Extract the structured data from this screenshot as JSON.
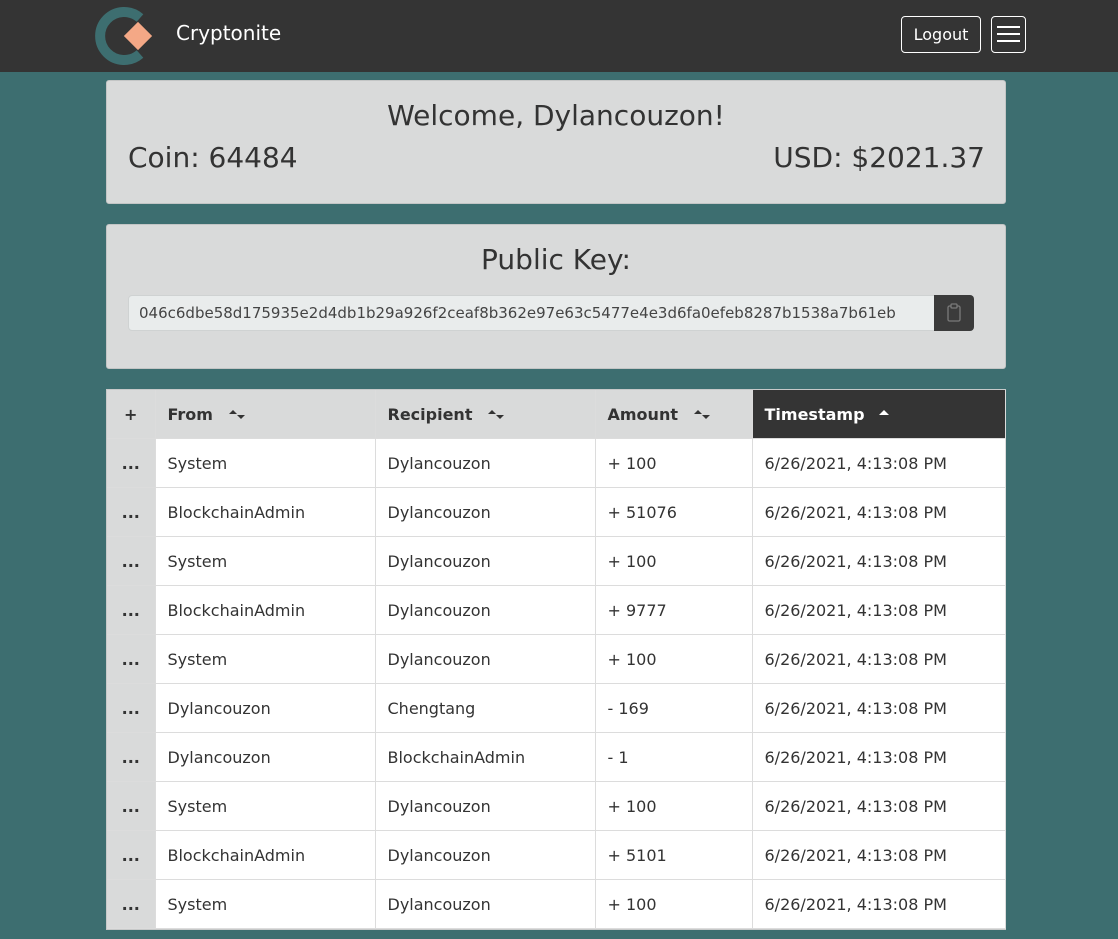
{
  "navbar": {
    "brand_name": "Cryptonite",
    "logout_label": "Logout",
    "colors": {
      "background": "#343434",
      "logo_ring": "#3d6e70",
      "logo_diamond": "#f4a886"
    }
  },
  "welcome": {
    "title": "Welcome, Dylancouzon!",
    "coin": "Coin: 64484",
    "usd": "USD: $2021.37"
  },
  "public_key": {
    "title": "Public Key:",
    "value": "046c6dbe58d175935e2d4db1b29a926f2ceaf8b362e97e63c5477e4e3d6fa0efeb8287b1538a7b61eb"
  },
  "table": {
    "add_label": "+",
    "columns": [
      "From",
      "Recipient",
      "Amount",
      "Timestamp"
    ],
    "active_sort_column": "Timestamp",
    "rows": [
      {
        "action": "...",
        "from": "System",
        "recipient": "Dylancouzon",
        "amount": "+ 100",
        "timestamp": "6/26/2021, 4:13:08 PM"
      },
      {
        "action": "...",
        "from": "BlockchainAdmin",
        "recipient": "Dylancouzon",
        "amount": "+ 51076",
        "timestamp": "6/26/2021, 4:13:08 PM"
      },
      {
        "action": "...",
        "from": "System",
        "recipient": "Dylancouzon",
        "amount": "+ 100",
        "timestamp": "6/26/2021, 4:13:08 PM"
      },
      {
        "action": "...",
        "from": "BlockchainAdmin",
        "recipient": "Dylancouzon",
        "amount": "+ 9777",
        "timestamp": "6/26/2021, 4:13:08 PM"
      },
      {
        "action": "...",
        "from": "System",
        "recipient": "Dylancouzon",
        "amount": "+ 100",
        "timestamp": "6/26/2021, 4:13:08 PM"
      },
      {
        "action": "...",
        "from": "Dylancouzon",
        "recipient": "Chengtang",
        "amount": "- 169",
        "timestamp": "6/26/2021, 4:13:08 PM"
      },
      {
        "action": "...",
        "from": "Dylancouzon",
        "recipient": "BlockchainAdmin",
        "amount": "- 1",
        "timestamp": "6/26/2021, 4:13:08 PM"
      },
      {
        "action": "...",
        "from": "System",
        "recipient": "Dylancouzon",
        "amount": "+ 100",
        "timestamp": "6/26/2021, 4:13:08 PM"
      },
      {
        "action": "...",
        "from": "BlockchainAdmin",
        "recipient": "Dylancouzon",
        "amount": "+ 5101",
        "timestamp": "6/26/2021, 4:13:08 PM"
      },
      {
        "action": "...",
        "from": "System",
        "recipient": "Dylancouzon",
        "amount": "+ 100",
        "timestamp": "6/26/2021, 4:13:08 PM"
      }
    ]
  },
  "icons": {
    "logo": "cryptonite-logo-icon",
    "menu": "hamburger-menu-icon",
    "copy": "clipboard-icon",
    "sort": "sort-updown-icon",
    "sort_active": "sort-ascending-icon"
  },
  "colors": {
    "page_background": "#3d6e70",
    "card_background": "#d9dada",
    "active_header": "#343434"
  }
}
